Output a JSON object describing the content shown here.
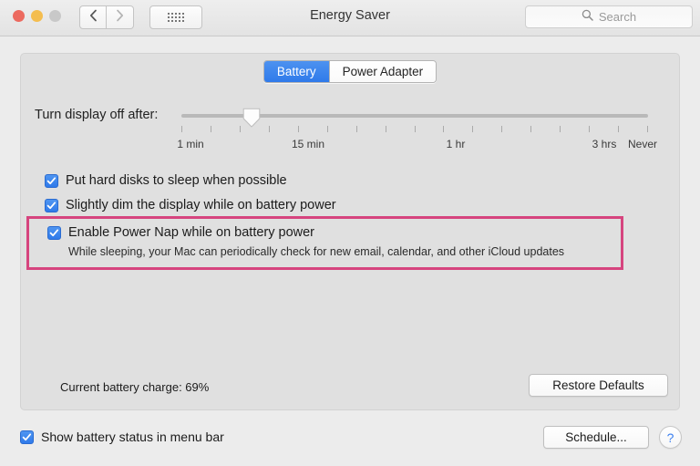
{
  "window": {
    "title": "Energy Saver",
    "traffic_lights": [
      {
        "name": "close",
        "color": "#ec6a5f"
      },
      {
        "name": "minimize",
        "color": "#f4bd4f"
      },
      {
        "name": "zoom",
        "color": "#c8c8c8"
      }
    ],
    "back_icon": "chevron-left-icon",
    "forward_icon": "chevron-right-icon",
    "grid_icon": "show-all-grid-icon"
  },
  "search": {
    "placeholder": "Search",
    "icon": "search-icon",
    "value": ""
  },
  "tabs": [
    {
      "label": "Battery",
      "selected": true
    },
    {
      "label": "Power Adapter",
      "selected": false
    }
  ],
  "slider": {
    "label": "Turn display off after:",
    "tick_labels": [
      "1 min",
      "15 min",
      "1 hr",
      "3 hrs",
      "Never"
    ],
    "tick_count": 17,
    "thumb_position_percent": 15,
    "value": "3 min"
  },
  "options": [
    {
      "id": "hard-disks-sleep",
      "label": "Put hard disks to sleep when possible",
      "checked": true,
      "highlighted": false
    },
    {
      "id": "slightly-dim",
      "label": "Slightly dim the display while on battery power",
      "checked": true,
      "highlighted": false
    },
    {
      "id": "power-nap",
      "label": "Enable Power Nap while on battery power",
      "description": "While sleeping, your Mac can periodically check for new email, calendar, and other iCloud updates",
      "checked": true,
      "highlighted": true
    }
  ],
  "status": {
    "battery_charge": "Current battery charge: 69%"
  },
  "buttons": {
    "restore_defaults": "Restore Defaults",
    "schedule": "Schedule...",
    "help": "?"
  },
  "footer": {
    "show_battery_status": {
      "label": "Show battery status in menu bar",
      "checked": true
    }
  },
  "colors": {
    "accent_blue": "#2f7aea",
    "highlight_pink": "#d6447e",
    "panel_bg": "#e0e0e0",
    "window_bg": "#ececec",
    "help_blue": "#3b7ff0"
  }
}
